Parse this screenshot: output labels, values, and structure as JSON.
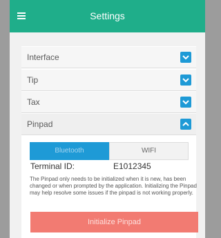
{
  "header": {
    "title": "Settings",
    "menu_icon": "hamburger-menu-icon"
  },
  "sections": [
    {
      "label": "Interface",
      "icon": "chevron-down-icon"
    },
    {
      "label": "Tip",
      "icon": "chevron-down-icon"
    },
    {
      "label": "Tax",
      "icon": "chevron-down-icon"
    },
    {
      "label": "Pinpad",
      "icon": "chevron-up-icon"
    }
  ],
  "pinpad": {
    "connection_options": [
      "Bluetooth",
      "WIFI"
    ],
    "selected_connection": "Bluetooth",
    "terminal_id_label": "Terminal ID:",
    "terminal_id_value": "E1012345",
    "note": "The Pinpad only needs to be initialized when it is new, has been changed or when prompted by the application. Initializing the Pinpad may help resolve some issues if the pinpad is not working properly.",
    "initialize_button": "Initialize Pinpad"
  },
  "colors": {
    "header": "#1fae8a",
    "accent": "#1e9ad6",
    "init_button": "#f27b72"
  }
}
